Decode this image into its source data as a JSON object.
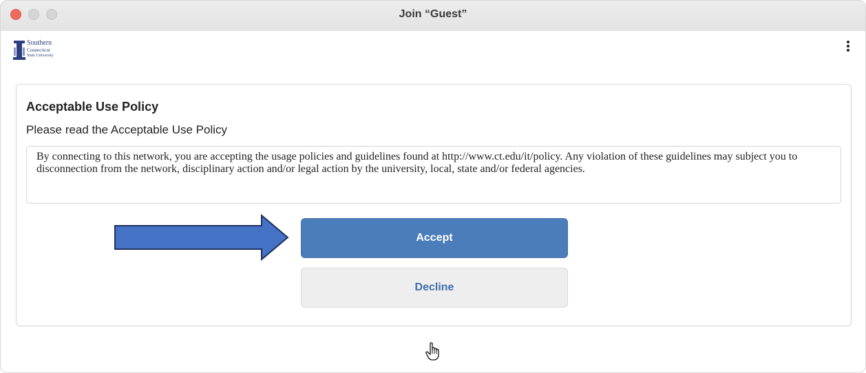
{
  "window": {
    "title": "Join “Guest”"
  },
  "header": {
    "logo_alt": "Southern Connecticut State University",
    "logo_line1": "Southern",
    "logo_line2": "Connecticut",
    "logo_line3": "State University",
    "menu_icon": "more-vertical-icon"
  },
  "policy": {
    "title": "Acceptable Use Policy",
    "subtitle": "Please read the Acceptable Use Policy",
    "text": "By connecting to this network, you are accepting the usage policies and guidelines found at http://www.ct.edu/it/policy. Any violation of these guidelines may subject you to disconnection from the network, disciplinary action and/or legal action by the university, local, state and/or federal agencies."
  },
  "actions": {
    "accept_label": "Accept",
    "decline_label": "Decline"
  },
  "colors": {
    "accent": "#4a7dba",
    "decline_text": "#3f6fa8",
    "arrow_fill": "#4472c4",
    "arrow_stroke": "#1f2f5f"
  }
}
